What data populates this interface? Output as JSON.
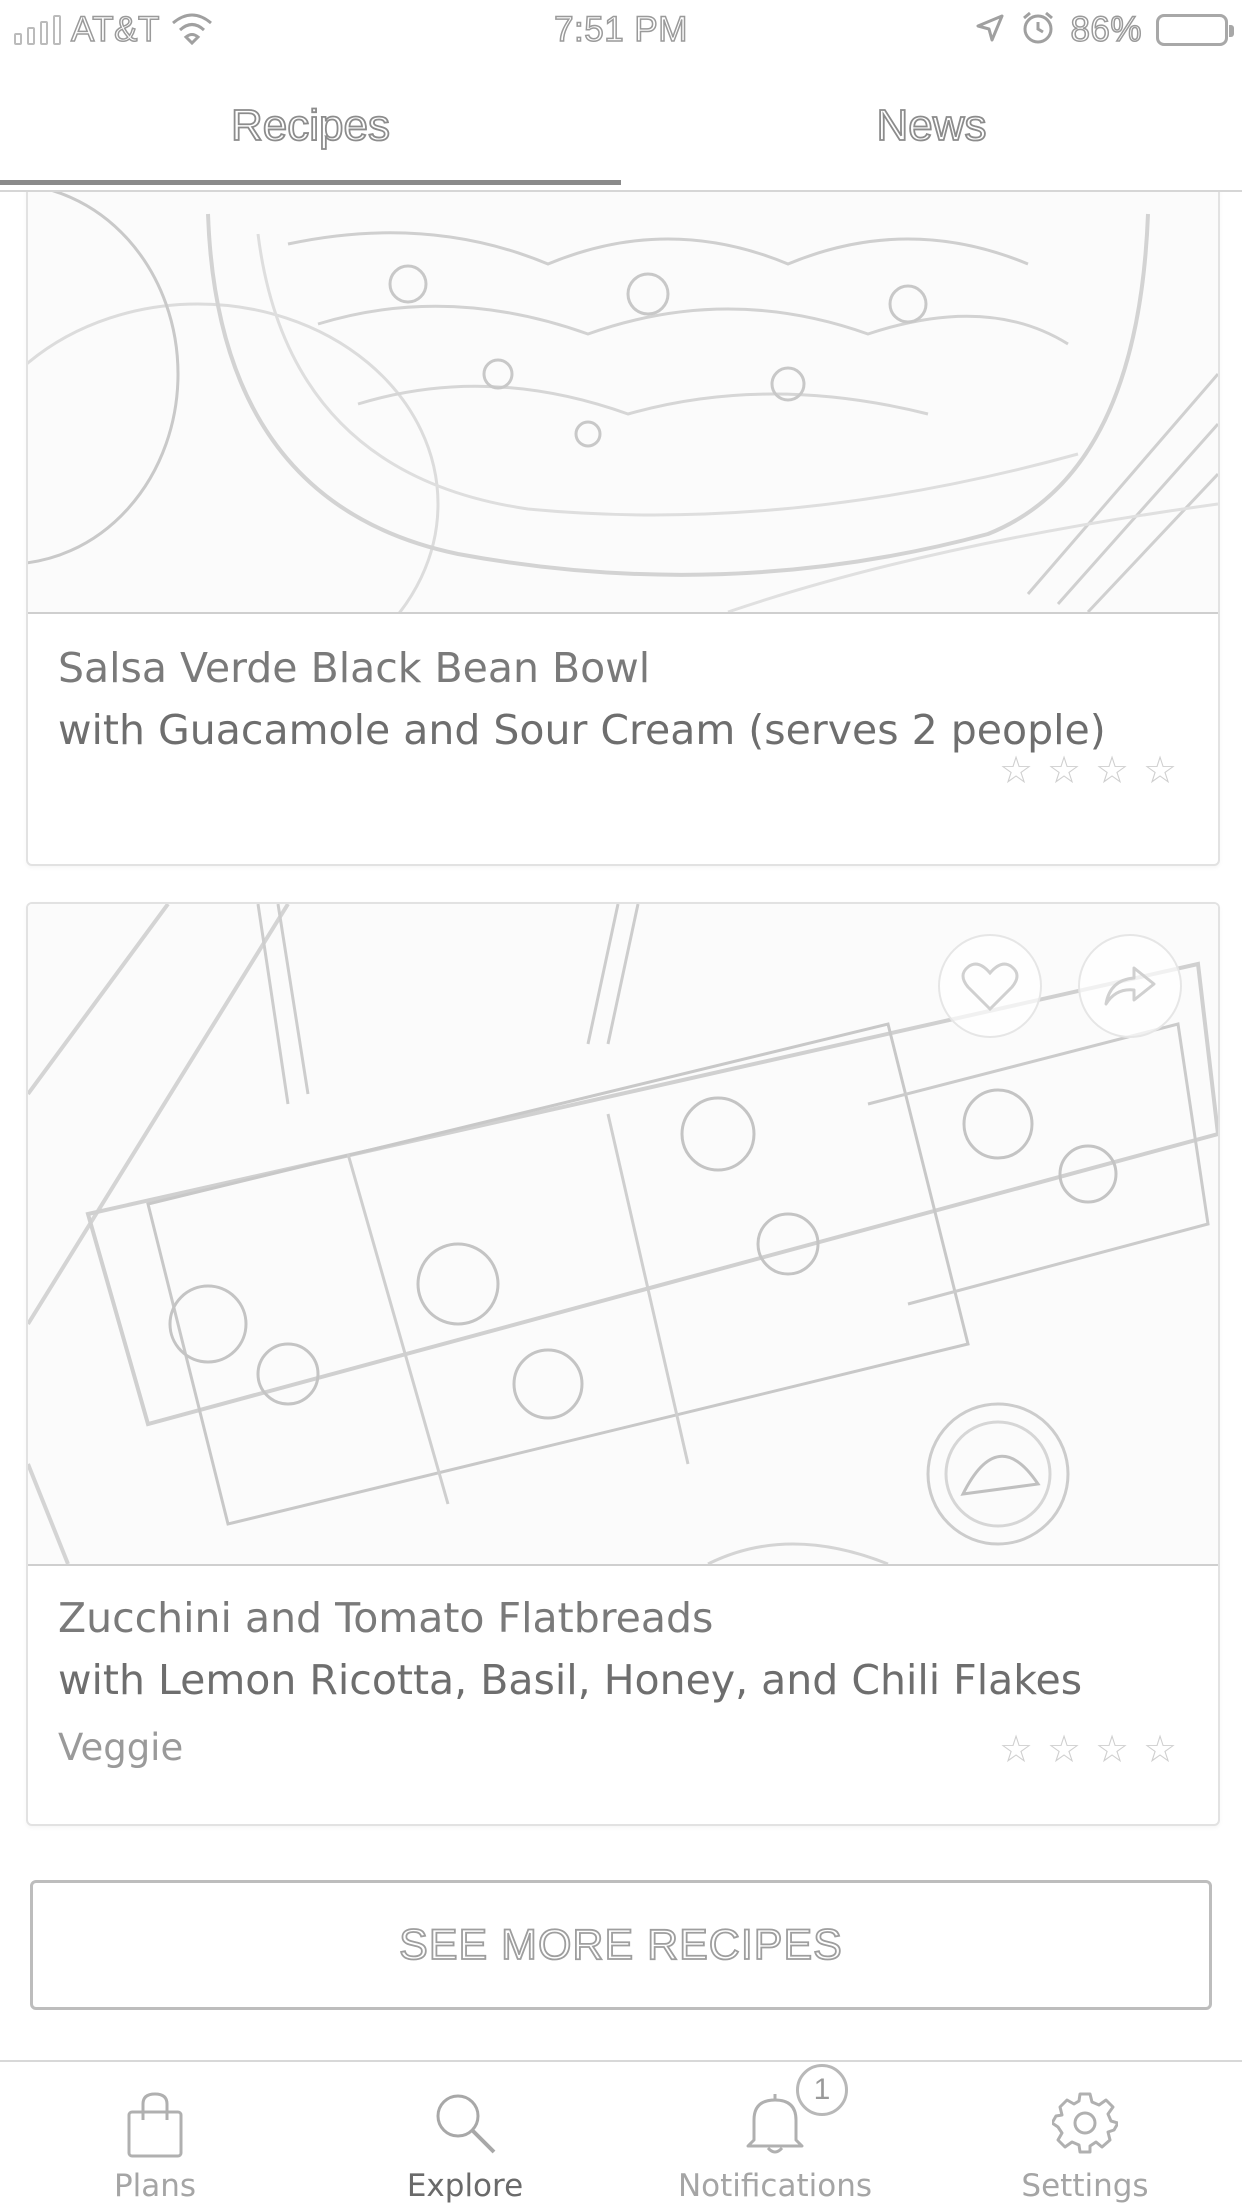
{
  "status_bar": {
    "carrier": "AT&T",
    "time": "7:51 PM",
    "battery": "86%",
    "icons": [
      "signal-icon",
      "wifi-icon",
      "location-arrow-icon",
      "alarm-icon",
      "battery-icon"
    ]
  },
  "top_tabs": [
    {
      "label": "Recipes",
      "selected": true
    },
    {
      "label": "News",
      "selected": false
    }
  ],
  "recipes": [
    {
      "title": "Salsa Verde Black Bean Bowl",
      "subtitle": "with Guacamole and Sour Cream (serves 2 people)",
      "tag": "",
      "rating": 0,
      "max_rating": 4
    },
    {
      "title": "Zucchini and Tomato Flatbreads",
      "subtitle": "with Lemon Ricotta, Basil, Honey, and Chili Flakes",
      "tag": "Veggie",
      "rating": 0,
      "max_rating": 4,
      "image_actions": [
        "heart-icon",
        "share-icon"
      ]
    }
  ],
  "see_more_label": "SEE MORE RECIPES",
  "bottom_nav": [
    {
      "label": "Plans",
      "icon": "shopping-bag-icon",
      "active": false
    },
    {
      "label": "Explore",
      "icon": "search-icon",
      "active": true
    },
    {
      "label": "Notifications",
      "icon": "bell-icon",
      "active": false,
      "badge": "1"
    },
    {
      "label": "Settings",
      "icon": "gear-icon",
      "active": false
    }
  ],
  "colors": {
    "text_primary": "#6e6e6e",
    "text_muted": "#a5a5a5",
    "border": "#e2e2e2",
    "indicator": "#8a8a8a"
  }
}
